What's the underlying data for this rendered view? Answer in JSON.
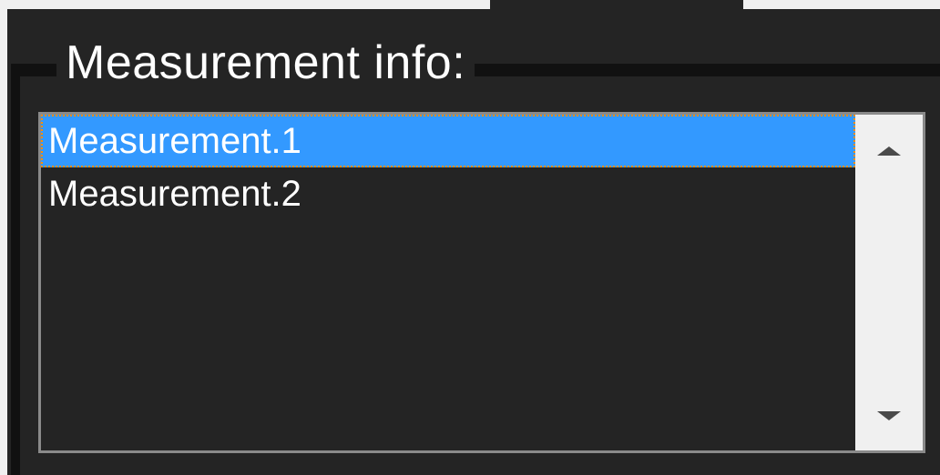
{
  "groupbox": {
    "title": "Measurement info:"
  },
  "listbox": {
    "items": [
      {
        "label": "Measurement.1",
        "selected": true
      },
      {
        "label": "Measurement.2",
        "selected": false
      }
    ],
    "scrollbar": {
      "up_icon": "scroll-up-arrow-icon",
      "down_icon": "scroll-down-arrow-icon"
    }
  },
  "colors": {
    "panel_bg": "#242424",
    "selection_bg": "#3399ff",
    "focus_outline": "#ff8c00",
    "text": "#ffffff"
  }
}
